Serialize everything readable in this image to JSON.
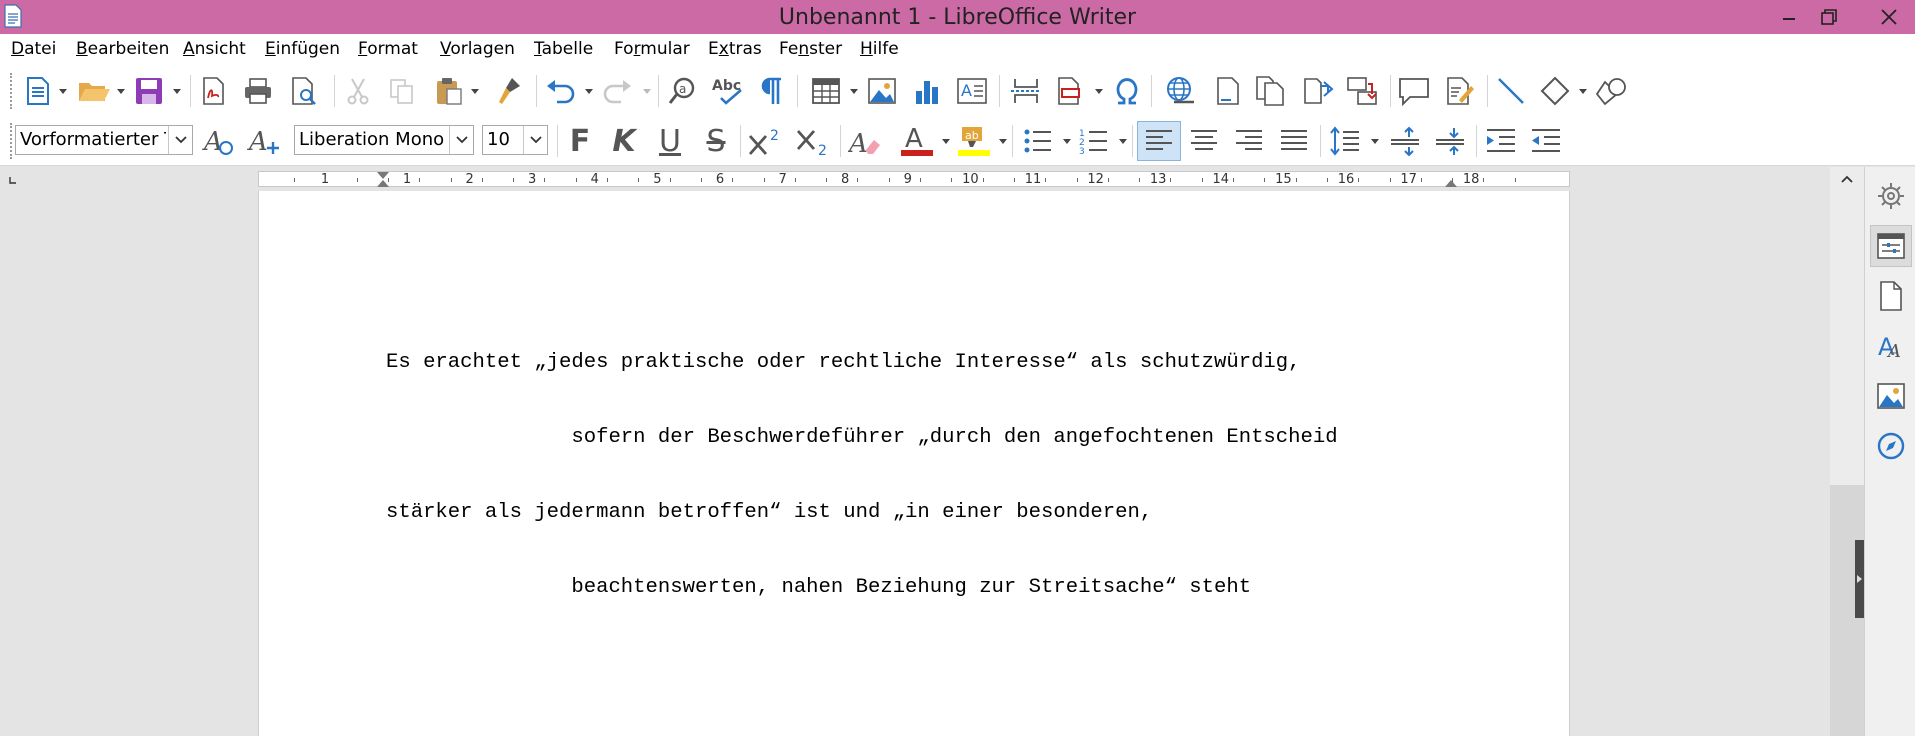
{
  "titlebar": {
    "title": "Unbenannt 1 - LibreOffice Writer"
  },
  "menu": [
    {
      "label": "Datei",
      "u": "D",
      "rest": "atei"
    },
    {
      "label": "Bearbeiten",
      "u": "B",
      "rest": "earbeiten"
    },
    {
      "label": "Ansicht",
      "u": "A",
      "rest": "nsicht"
    },
    {
      "label": "Einfügen",
      "u": "E",
      "rest": "infügen"
    },
    {
      "label": "Format",
      "u": "F",
      "rest": "ormat"
    },
    {
      "label": "Vorlagen",
      "u": "V",
      "rest": "orlagen"
    },
    {
      "label": "Tabelle",
      "u": "T",
      "rest": "abelle"
    },
    {
      "label": "Formular",
      "u": "r",
      "pre": "Fo",
      "rest": "mular"
    },
    {
      "label": "Extras",
      "u": "x",
      "pre": "E",
      "rest": "tras"
    },
    {
      "label": "Fenster",
      "u": "n",
      "pre": "Fe",
      "rest": "ster"
    },
    {
      "label": "Hilfe",
      "u": "H",
      "rest": "ilfe"
    }
  ],
  "formatting": {
    "paragraph_style": "Vorformatierter Text",
    "font_name": "Liberation Mono",
    "font_size": "10",
    "bold_glyph": "F",
    "italic_glyph": "K",
    "underline_glyph": "U",
    "strike_glyph": "S"
  },
  "ruler": {
    "labels": [
      "1",
      "1",
      "2",
      "3",
      "4",
      "5",
      "6",
      "7",
      "8",
      "9",
      "10",
      "11",
      "12",
      "13",
      "14",
      "15",
      "16",
      "17",
      "18"
    ]
  },
  "document": {
    "lines": [
      "Es erachtet „jedes praktische oder rechtliche Interesse“ als schutzwürdig,",
      "               sofern der Beschwerdeführer „durch den angefochtenen Entscheid",
      "stärker als jedermann betroffen“ ist und „in einer besonderen,",
      "               beachtenswerten, nahen Beziehung zur Streitsache“ steht"
    ]
  },
  "colors": {
    "titlebar": "#cb6aa4",
    "font_color_bar": "#c9211e",
    "highlight_bar": "#ffff00",
    "icon_blue": "#2a76c6",
    "icon_purple": "#8e3cb5"
  },
  "icons": {
    "toolbar1": [
      "new-document-icon",
      "open-icon",
      "save-icon",
      "export-pdf-icon",
      "print-icon",
      "print-preview-icon",
      "cut-icon",
      "copy-icon",
      "paste-icon",
      "clone-formatting-icon",
      "undo-icon",
      "redo-icon",
      "find-replace-icon",
      "spelling-icon",
      "formatting-marks-icon",
      "insert-table-icon",
      "insert-image-icon",
      "insert-chart-icon",
      "insert-textbox-icon",
      "page-break-icon",
      "insert-field-icon",
      "special-character-icon",
      "hyperlink-icon",
      "footnote-icon",
      "endnote-icon",
      "bookmark-icon",
      "cross-reference-icon",
      "comment-icon",
      "track-changes-icon",
      "line-icon",
      "basic-shapes-icon",
      "shapes-icon"
    ],
    "sidebar": [
      "properties-icon",
      "page-icon",
      "styles-icon",
      "gallery-icon",
      "navigator-icon"
    ]
  }
}
